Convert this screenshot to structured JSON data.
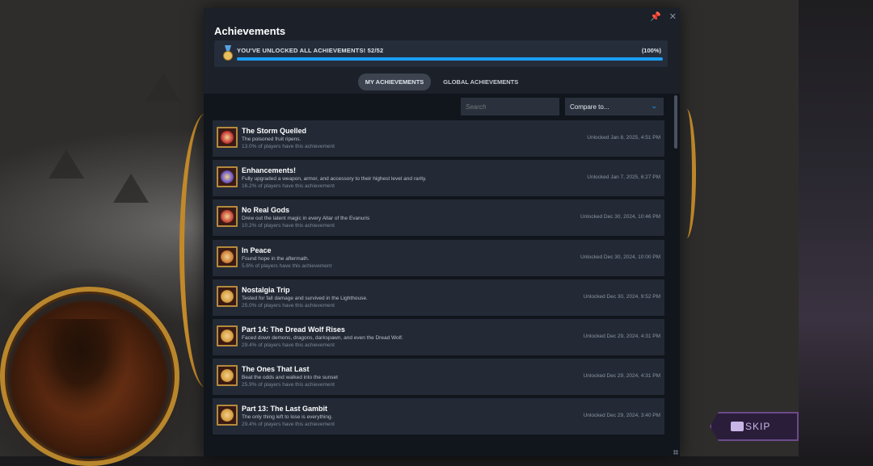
{
  "overlay": {
    "title": "Achievements",
    "pin_icon": "pin-icon",
    "close_icon": "close-icon",
    "progress": {
      "label": "YOU'VE UNLOCKED ALL ACHIEVEMENTS! 52/52",
      "percent_text": "(100%)",
      "fraction": 1.0
    },
    "tabs": [
      {
        "label": "MY ACHIEVEMENTS",
        "active": true
      },
      {
        "label": "GLOBAL ACHIEVEMENTS",
        "active": false
      }
    ],
    "search": {
      "placeholder": "Search"
    },
    "compare": {
      "label": "Compare to..."
    },
    "accent_color": "#1a9fff"
  },
  "achievements": [
    {
      "name": "The Storm Quelled",
      "desc": "The poisoned fruit ripens.",
      "pct": "13.0% of players have this achievement",
      "date": "Unlocked Jan 8, 2025, 4:51 PM",
      "icon_color": "#c83a3a"
    },
    {
      "name": "Enhancements!",
      "desc": "Fully upgraded a weapon, armor, and accessory to their highest level and rarity.",
      "pct": "16.2% of players have this achievement",
      "date": "Unlocked Jan 7, 2025, 6:27 PM",
      "icon_color": "#6a5ac8"
    },
    {
      "name": "No Real Gods",
      "desc": "Drew out the latent magic in every Altar of the Evanuris",
      "pct": "10.2% of players have this achievement",
      "date": "Unlocked Dec 30, 2024, 10:46 PM",
      "icon_color": "#c84a3a"
    },
    {
      "name": "In Peace",
      "desc": "Found hope in the aftermath.",
      "pct": "5.6% of players have this achievement",
      "date": "Unlocked Dec 30, 2024, 10:00 PM",
      "icon_color": "#d0803a"
    },
    {
      "name": "Nostalgia Trip",
      "desc": "Tested for fall damage and survived in the Lighthouse.",
      "pct": "25.0% of players have this achievement",
      "date": "Unlocked Dec 30, 2024, 9:52 PM",
      "icon_color": "#d8a040"
    },
    {
      "name": "Part 14: The Dread Wolf Rises",
      "desc": "Faced down demons, dragons, darkspawn, and even the Dread Wolf.",
      "pct": "29.4% of players have this achievement",
      "date": "Unlocked Dec 29, 2024, 4:31 PM",
      "icon_color": "#d8a040"
    },
    {
      "name": "The Ones That Last",
      "desc": "Beat the odds and walked into the sunset",
      "pct": "25.9% of players have this achievement",
      "date": "Unlocked Dec 29, 2024, 4:31 PM",
      "icon_color": "#d8a040"
    },
    {
      "name": "Part 13: The Last Gambit",
      "desc": "The only thing left to lose is everything.",
      "pct": "29.4% of players have this achievement",
      "date": "Unlocked Dec 29, 2024, 3:40 PM",
      "icon_color": "#d8a040"
    }
  ],
  "game": {
    "skip_label": "SKIP",
    "skip_icon": "keyboard-key-icon"
  }
}
